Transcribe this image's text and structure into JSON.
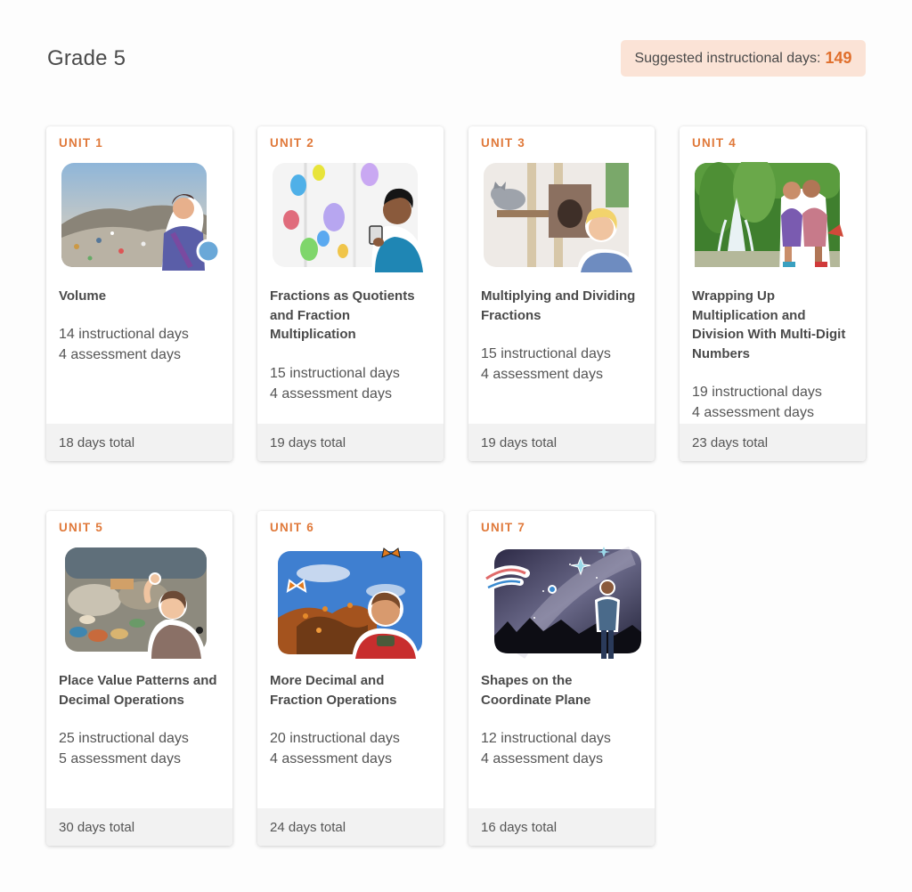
{
  "header": {
    "title": "Grade 5",
    "suggested_label": "Suggested instructional days:",
    "suggested_value": "149"
  },
  "units": [
    {
      "label": "UNIT 1",
      "title": "Volume",
      "instructional": "14 instructional days",
      "assessment": "4 assessment days",
      "total": "18 days total"
    },
    {
      "label": "UNIT 2",
      "title": "Fractions as Quotients and Fraction Multiplication",
      "instructional": "15 instructional days",
      "assessment": "4 assessment days",
      "total": "19 days total"
    },
    {
      "label": "UNIT 3",
      "title": "Multiplying and Dividing Fractions",
      "instructional": "15 instructional days",
      "assessment": "4 assessment days",
      "total": "19 days total"
    },
    {
      "label": "UNIT 4",
      "title": "Wrapping Up Multiplication and Division With Multi-Digit Numbers",
      "instructional": "19 instructional days",
      "assessment": "4 assessment days",
      "total": "23 days total"
    },
    {
      "label": "UNIT 5",
      "title": "Place Value Patterns and Decimal Operations",
      "instructional": "25 instructional days",
      "assessment": "5 assessment days",
      "total": "30 days total"
    },
    {
      "label": "UNIT 6",
      "title": "More Decimal and Fraction Operations",
      "instructional": "20 instructional days",
      "assessment": "4 assessment days",
      "total": "24 days total"
    },
    {
      "label": "UNIT 7",
      "title": "Shapes on the Coordinate Plane",
      "instructional": "12 instructional days",
      "assessment": "4 assessment days",
      "total": "16 days total"
    }
  ],
  "colors": {
    "accent": "#e0793a",
    "pill_bg": "#fbe3d6",
    "footer_bg": "#f2f2f2"
  }
}
